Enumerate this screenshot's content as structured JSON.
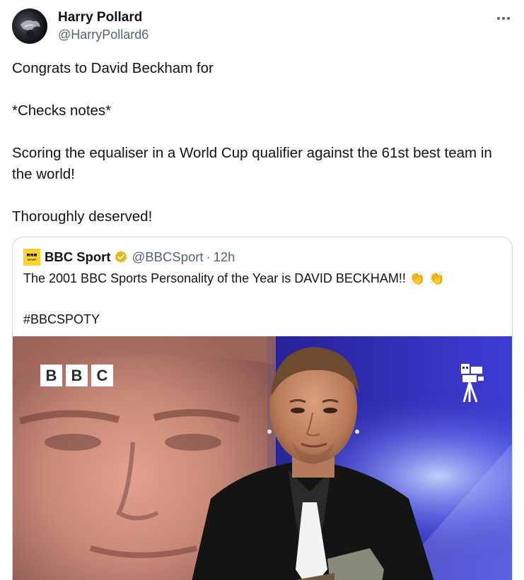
{
  "author": {
    "name": "Harry Pollard",
    "handle": "@HarryPollard6"
  },
  "tweet": {
    "text": "Congrats to David Beckham for\n\n*Checks notes*\n\nScoring the equaliser in a World Cup qualifier against the 61st best team in the world!\n\nThoroughly deserved!"
  },
  "quoted": {
    "name": "BBC Sport",
    "handle": "@BBCSport",
    "separator": "·",
    "time": "12h",
    "text": "The 2001 BBC Sports Personality of the Year is DAVID BECKHAM!! 👏 👏\n\n#BBCSPOTY",
    "logo_lines": [
      "BBC",
      "SPORT"
    ],
    "media_brand_letters": [
      "B",
      "B",
      "C"
    ]
  },
  "colors": {
    "text": "#0f1419",
    "secondary": "#536471",
    "border": "#cfd9de",
    "bbc_yellow": "#ffd230",
    "verified_gold": "#e2b719"
  },
  "icons": {
    "more": "more-horizontal-icon",
    "verified": "verified-badge-icon",
    "camera": "film-camera-icon"
  }
}
